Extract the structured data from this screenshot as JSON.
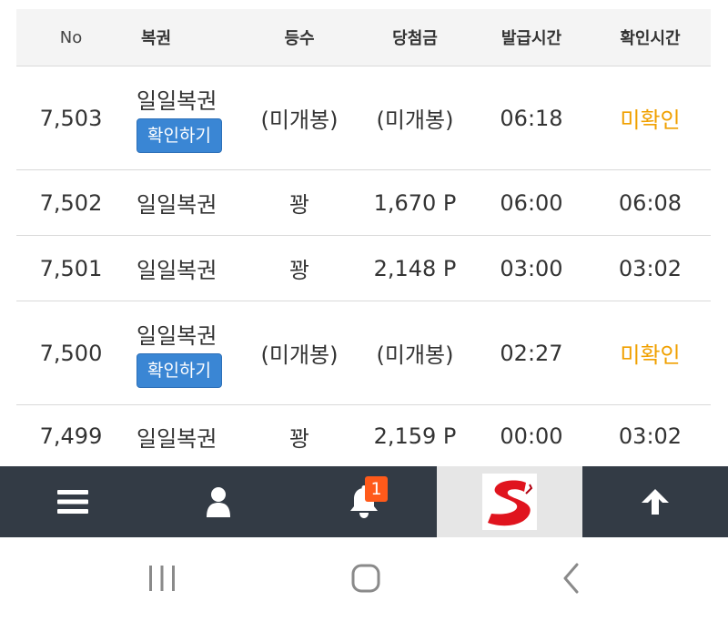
{
  "table": {
    "headers": [
      "No",
      "복권",
      "등수",
      "당첨금",
      "발급시간",
      "확인시간"
    ],
    "rows": [
      {
        "no": "7,503",
        "ticket": "일일복권",
        "action": "확인하기",
        "rank": "(미개봉)",
        "prize": "(미개봉)",
        "issued": "06:18",
        "checked": "미확인"
      },
      {
        "no": "7,502",
        "ticket": "일일복권",
        "rank": "꽝",
        "prize": "1,670 P",
        "issued": "06:00",
        "checked": "06:08"
      },
      {
        "no": "7,501",
        "ticket": "일일복권",
        "rank": "꽝",
        "prize": "2,148 P",
        "issued": "03:00",
        "checked": "03:02"
      },
      {
        "no": "7,500",
        "ticket": "일일복권",
        "action": "확인하기",
        "rank": "(미개봉)",
        "prize": "(미개봉)",
        "issued": "02:27",
        "checked": "미확인"
      },
      {
        "no": "7,499",
        "ticket": "일일복권",
        "rank": "꽝",
        "prize": "2,159 P",
        "issued": "00:00",
        "checked": "03:02"
      }
    ]
  },
  "bottom_nav": {
    "items": [
      "menu-icon",
      "user-icon",
      "bell-icon",
      "site-logo",
      "arrow-up-icon"
    ],
    "notification_count": "1"
  },
  "system_nav": {
    "items": [
      "recent-apps-icon",
      "home-icon",
      "back-icon"
    ]
  },
  "colors": {
    "header_bg": "#f4f4f4",
    "button_blue": "#3a86d4",
    "unconfirmed_orange": "#f0a000",
    "nav_bg": "#333b45",
    "badge": "#ff5a1a",
    "logo_red": "#e0141e"
  }
}
